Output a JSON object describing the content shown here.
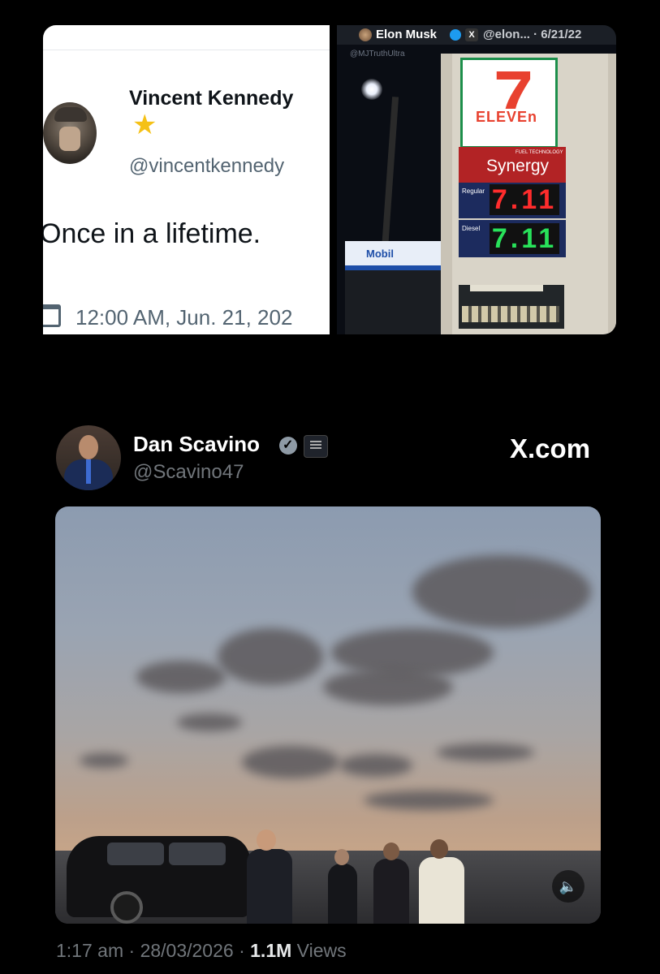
{
  "left_tweet": {
    "name": "Vincent Kennedy",
    "star": "★",
    "handle": "@vincentkennedy",
    "text": "Once in a lifetime.",
    "timestamp": "12:00 AM, Jun. 21, 202"
  },
  "right_tweet": {
    "name": "Elon Musk",
    "x_badge": "X",
    "header_rest": "@elon... · 6/21/22",
    "watermark": "@MJTruthUltra",
    "sign": {
      "brand_number": "7",
      "brand_word": "ELEVEn",
      "fuel_small": "FUEL TECHNOLOGY",
      "fuel_brand": "Synergy",
      "regular_label": "Regular",
      "regular_price": "7.11",
      "diesel_label": "Diesel",
      "diesel_price": "7.11",
      "station_brand": "Mobil",
      "store_number": "7"
    }
  },
  "main_tweet": {
    "name": "Dan Scavino",
    "handle": "@Scavino47",
    "site": "X.com",
    "time": "1:17 am",
    "date": "28/03/2026",
    "views_count": "1.1M",
    "views_label": "Views",
    "sep": "·"
  },
  "icons": [
    "star-icon",
    "calendar-icon",
    "verified-icon",
    "x-logo-icon",
    "speaker-icon"
  ],
  "colors": {
    "background": "#000000",
    "accent": "#1d9bf0",
    "muted": "#71767b",
    "price_regular": "#ff2c2c",
    "price_diesel": "#28e25a"
  }
}
